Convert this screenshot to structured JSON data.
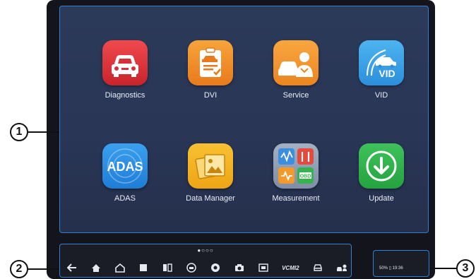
{
  "apps": [
    {
      "label": "Diagnostics",
      "icon": "car-front-icon",
      "color": "#e3363c"
    },
    {
      "label": "DVI",
      "icon": "clipboard-car-icon",
      "color": "#f08a24"
    },
    {
      "label": "Service",
      "icon": "mechanic-icon",
      "color": "#f0922a"
    },
    {
      "label": "VID",
      "icon": "vid-car-icon",
      "color": "#3aa3e6"
    },
    {
      "label": "ADAS",
      "icon": "adas-icon",
      "color": "#2f8fe0"
    },
    {
      "label": "Data Manager",
      "icon": "photo-folder-icon",
      "color": "#f2b01e"
    },
    {
      "label": "Measurement",
      "icon": "measurement-tools-icon",
      "color": "#8c9bb0"
    },
    {
      "label": "Update",
      "icon": "download-arrow-icon",
      "color": "#2fb34a"
    }
  ],
  "adas_text": "ADAS",
  "vid_text": "VID",
  "obd_text": "OBD",
  "page_indicator": "●○○○",
  "nav_icons": [
    "back-icon",
    "home-icon",
    "house-icon",
    "recent-apps-icon",
    "split-screen-icon",
    "vehicle-icon",
    "browser-icon",
    "camera-icon",
    "screen-mirror-icon",
    "vcmi-icon",
    "car-icon",
    "mechanic-settings-icon"
  ],
  "vcmi_text": "VCMI2",
  "status": {
    "text": "50% ▯ 19:36"
  },
  "callouts": [
    "1",
    "2",
    "3"
  ],
  "colors": {
    "accent": "#2f7fd4",
    "background": "#293656"
  }
}
